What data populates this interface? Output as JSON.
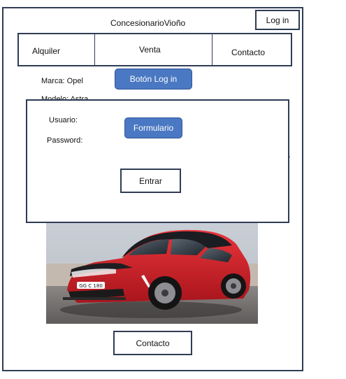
{
  "header": {
    "title": "ConcesionarioVioño",
    "login_label": "Log in"
  },
  "nav": {
    "items": [
      {
        "label": "Alquiler"
      },
      {
        "label": "Venta"
      },
      {
        "label": "Contacto"
      }
    ]
  },
  "details": {
    "marca": "Marca: Opel",
    "modelo": "Modelo: Astra"
  },
  "annotations": {
    "login_callout": "Botón  Log in",
    "form_callout": "Formulario"
  },
  "login_form": {
    "usuario_label": "Usuario:",
    "password_label": "Password:",
    "submit_label": "Entrar"
  },
  "car": {
    "plate_text": "GG C 180",
    "icon": "red-hatchback-car-photo"
  },
  "footer": {
    "contact_label": "Contacto"
  },
  "colors": {
    "frame_border": "#2f3c54",
    "callout_fill": "#4a78c2",
    "callout_text": "#ffffff",
    "car_red": "#d8262e"
  }
}
